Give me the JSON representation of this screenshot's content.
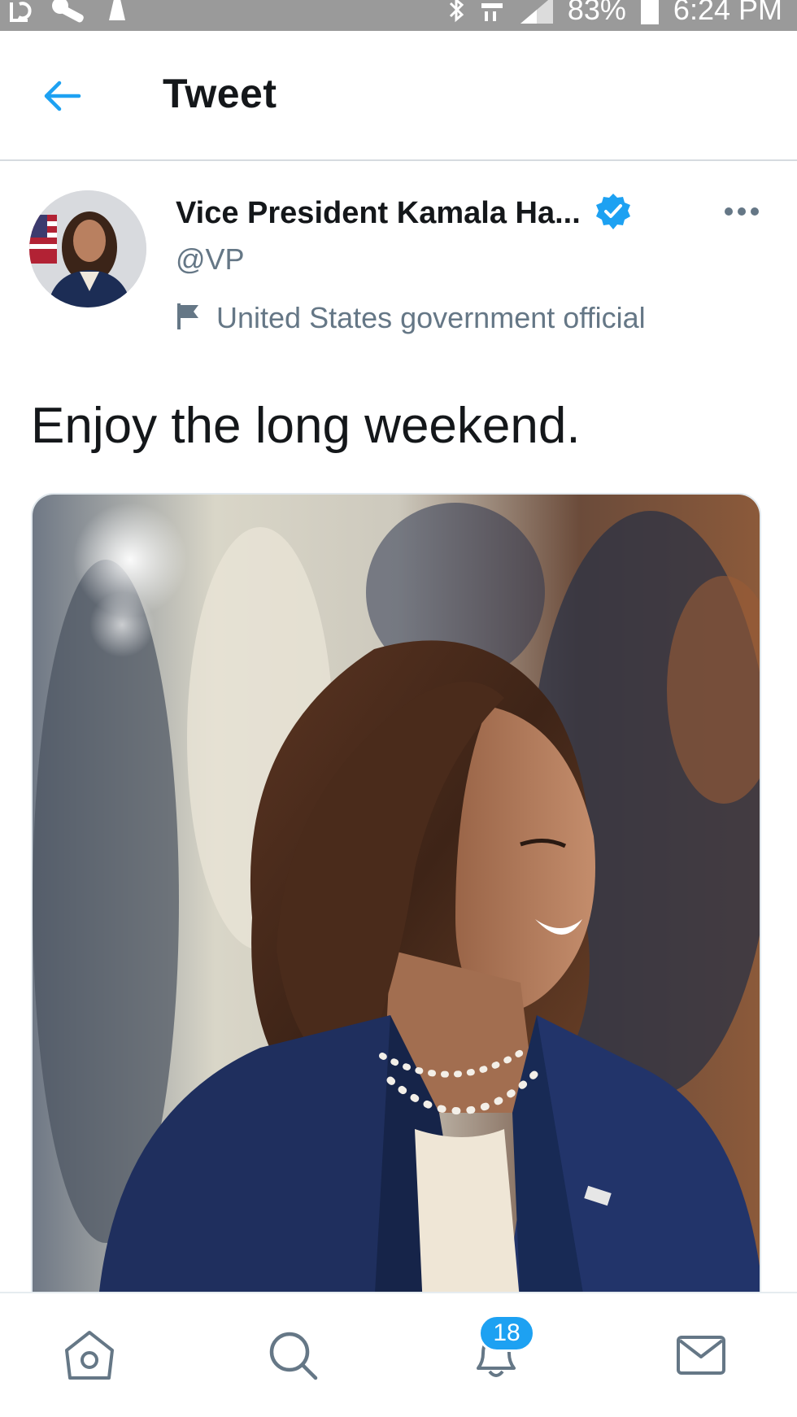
{
  "status_bar": {
    "battery": "83%",
    "time": "6:24 PM",
    "icons": [
      "refresh-icon",
      "wrench-icon",
      "notification-icon",
      "bluetooth-icon",
      "data-icon",
      "signal-icon",
      "battery-icon"
    ]
  },
  "header": {
    "title": "Tweet",
    "back_icon": "arrow-left-icon"
  },
  "tweet": {
    "author": {
      "display_name": "Vice President Kamala Ha...",
      "handle": "@VP",
      "verified": true,
      "label": "United States government official",
      "label_icon": "flag-icon"
    },
    "text": "Enjoy the long weekend.",
    "media_description": "photo"
  },
  "bottom_nav": {
    "items": [
      "home-icon",
      "search-icon",
      "notifications-icon",
      "messages-icon"
    ],
    "notification_count": "18"
  },
  "colors": {
    "accent": "#1da1f2",
    "text_primary": "#14171a",
    "text_secondary": "#657786",
    "status_bar": "#9a9a9a"
  }
}
